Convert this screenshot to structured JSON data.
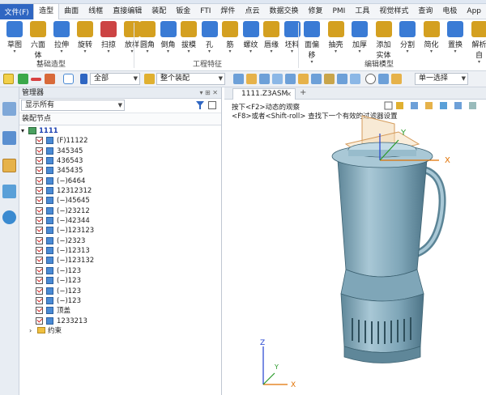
{
  "menubar": {
    "file": "文件(F)",
    "items": [
      "造型",
      "曲面",
      "线框",
      "直接编辑",
      "装配",
      "钣金",
      "FTI",
      "焊件",
      "点云",
      "数据交换",
      "修复",
      "PMI",
      "工具",
      "视觉样式",
      "查询",
      "电极",
      "App"
    ],
    "active_index": 0
  },
  "ribbon": {
    "groups": [
      {
        "label": "基础造型",
        "buttons": [
          {
            "label": "草图",
            "icon": "sketch-icon",
            "color": "#3a7bd5"
          },
          {
            "label": "六面体",
            "icon": "cube-icon",
            "color": "#d4a020"
          },
          {
            "label": "拉伸",
            "icon": "extrude-icon",
            "color": "#3a7bd5"
          },
          {
            "label": "旋转",
            "icon": "revolve-icon",
            "color": "#d4a020"
          },
          {
            "label": "扫掠",
            "icon": "sweep-icon",
            "color": "#c44"
          },
          {
            "label": "放样",
            "icon": "loft-icon",
            "color": "#d4a020"
          }
        ]
      },
      {
        "label": "工程特征",
        "buttons": [
          {
            "label": "圆角",
            "icon": "fillet-icon",
            "color": "#d4a020"
          },
          {
            "label": "倒角",
            "icon": "chamfer-icon",
            "color": "#3a7bd5"
          },
          {
            "label": "拔模",
            "icon": "draft-icon",
            "color": "#d4a020"
          },
          {
            "label": "孔",
            "icon": "hole-icon",
            "color": "#3a7bd5"
          },
          {
            "label": "筋",
            "icon": "rib-icon",
            "color": "#d4a020"
          },
          {
            "label": "螺纹",
            "icon": "thread-icon",
            "color": "#3a7bd5"
          },
          {
            "label": "唇缘",
            "icon": "lip-icon",
            "color": "#d4a020"
          },
          {
            "label": "坯料",
            "icon": "stock-icon",
            "color": "#3a7bd5"
          }
        ]
      },
      {
        "label": "编辑模型",
        "buttons": [
          {
            "label": "面偏移",
            "icon": "face-offset-icon",
            "color": "#3a7bd5"
          },
          {
            "label": "抽壳",
            "icon": "shell-icon",
            "color": "#d4a020"
          },
          {
            "label": "加厚",
            "icon": "thicken-icon",
            "color": "#3a7bd5"
          },
          {
            "label": "添加实体",
            "icon": "add-solid-icon",
            "color": "#d4a020"
          },
          {
            "label": "分割",
            "icon": "split-icon",
            "color": "#3a7bd5"
          },
          {
            "label": "简化",
            "icon": "simplify-icon",
            "color": "#d4a020"
          },
          {
            "label": "置换",
            "icon": "replace-icon",
            "color": "#3a7bd5"
          },
          {
            "label": "解析自",
            "icon": "analyze-icon",
            "color": "#d4a020"
          }
        ]
      }
    ]
  },
  "toolbar": {
    "filter_all": "全部",
    "assembly_scope": "整个装配",
    "selection_mode": "单一选择"
  },
  "manager": {
    "title": "管理器",
    "filter_value": "显示所有",
    "column_header": "装配节点",
    "root": "1111",
    "nodes": [
      "(F)11122",
      "345345",
      "436543",
      "345435",
      "(−)6464",
      "12312312",
      "(−)45645",
      "(−)23212",
      "(−)42344",
      "(−)123123",
      "(−)2323",
      "(−)12313",
      "(−)123132",
      "(−)123",
      "(−)123",
      "(−)123",
      "(−)123",
      "顶盖",
      "1233213"
    ],
    "constraints": "约束"
  },
  "document": {
    "tab_title": "1111.Z3ASM",
    "hint_line1": "按下<F2>动态的观察",
    "hint_line2": "<F8>或者<Shift-roll> 查找下一个有效的过滤器设置",
    "axis_x": "X",
    "axis_y": "Y",
    "axis_z": "Z"
  },
  "colors": {
    "accent": "#2f66c2",
    "model_body": "#7fa6b8",
    "model_dark": "#4d7487",
    "model_light": "#a9c8d6",
    "axis_x": "#e07000",
    "axis_y": "#2a9a2a",
    "axis_z": "#2040d0"
  }
}
